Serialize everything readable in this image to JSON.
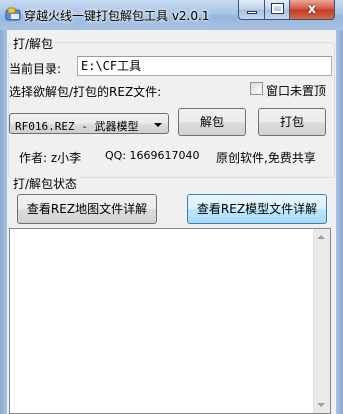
{
  "window": {
    "title": "穿越火线一键打包解包工具 v2.0.1",
    "close_glyph": "x"
  },
  "pack_group": {
    "legend": "打/解包",
    "current_dir_label": "当前目录:",
    "current_dir_value": "E:\\CF工具",
    "select_label": "选择欲解包/打包的REZ文件:",
    "topmost_label": "窗口未置顶",
    "topmost_checked": false,
    "rez_selected": "RF016.REZ - 武器模型",
    "unpack_button": "解包",
    "pack_button": "打包",
    "author": "作者: z小李",
    "qq": "QQ: 1669617040",
    "license": "原创软件,免费共享"
  },
  "status_group": {
    "legend": "打/解包状态",
    "map_details_button": "查看REZ地图文件详解",
    "model_details_button": "查看REZ模型文件详解"
  }
}
